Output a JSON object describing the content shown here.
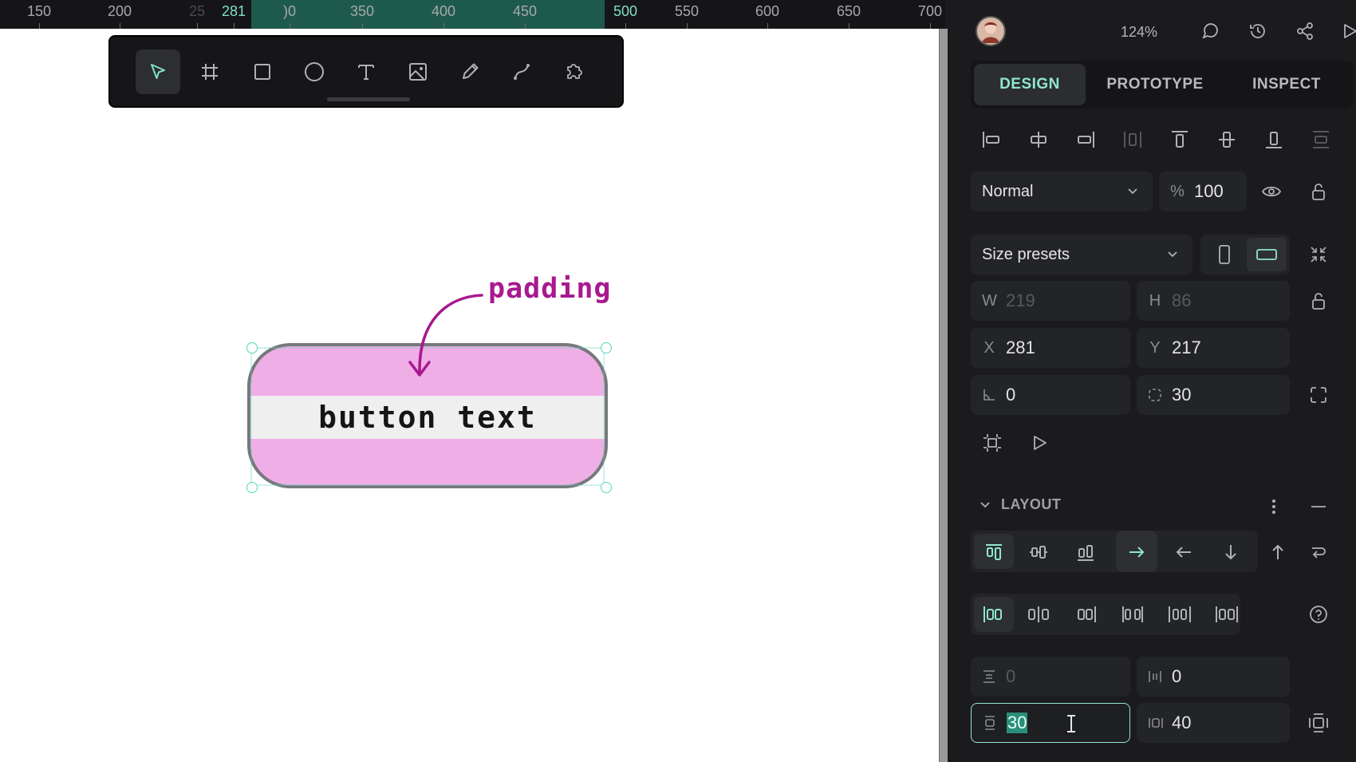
{
  "ruler": {
    "ticks": [
      {
        "label": "150",
        "state": "normal"
      },
      {
        "label": "200",
        "state": "normal"
      },
      {
        "label": "25",
        "state": "dim"
      },
      {
        "label": "281",
        "state": "selected"
      },
      {
        "label": ")0",
        "state": "normal"
      },
      {
        "label": "350",
        "state": "normal"
      },
      {
        "label": "400",
        "state": "normal"
      },
      {
        "label": "450",
        "state": "normal"
      },
      {
        "label": "500",
        "state": "selected"
      },
      {
        "label": "550",
        "state": "normal"
      },
      {
        "label": "600",
        "state": "normal"
      },
      {
        "label": "650",
        "state": "normal"
      },
      {
        "label": "700",
        "state": "normal"
      }
    ]
  },
  "toolbar": {
    "tools": [
      {
        "name": "move-tool",
        "icon": "pointer-icon",
        "active": true
      },
      {
        "name": "board-tool",
        "icon": "frame-icon",
        "active": false
      },
      {
        "name": "rectangle-tool",
        "icon": "rectangle-icon",
        "active": false
      },
      {
        "name": "ellipse-tool",
        "icon": "ellipse-icon",
        "active": false
      },
      {
        "name": "text-tool",
        "icon": "text-icon",
        "active": false
      },
      {
        "name": "image-tool",
        "icon": "image-icon",
        "active": false
      },
      {
        "name": "pencil-tool",
        "icon": "pencil-icon",
        "active": false
      },
      {
        "name": "path-tool",
        "icon": "path-icon",
        "active": false
      },
      {
        "name": "plugins-tool",
        "icon": "puzzle-icon",
        "active": false
      }
    ]
  },
  "canvas": {
    "button_text": "button text",
    "annotation": "padding",
    "colors": {
      "padding": "#f0aee6",
      "content": "#efefef",
      "annotation": "#a8198f",
      "selection": "#57d6b9"
    }
  },
  "header": {
    "zoom": "124%"
  },
  "tabs": [
    {
      "label": "DESIGN",
      "active": true
    },
    {
      "label": "PROTOTYPE",
      "active": false
    },
    {
      "label": "INSPECT",
      "active": false
    }
  ],
  "layer": {
    "blend_mode": "Normal",
    "opacity_prefix": "%",
    "opacity": "100"
  },
  "measures": {
    "size_presets": "Size presets",
    "w_label": "W",
    "w": "219",
    "h_label": "H",
    "h": "86",
    "x_label": "X",
    "x": "281",
    "y_label": "Y",
    "y": "217",
    "rotation": "0",
    "radius": "30"
  },
  "layout": {
    "title": "LAYOUT",
    "row_gap": "0",
    "column_gap": "0",
    "vertical_padding": "30",
    "horizontal_padding": "40"
  },
  "accent": "#8fe6cf"
}
